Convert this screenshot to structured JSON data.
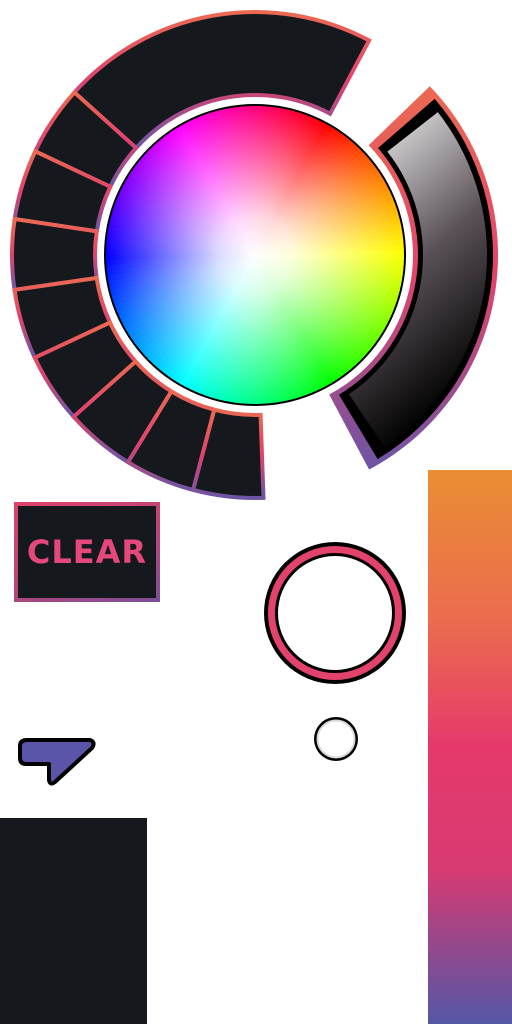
{
  "colors": {
    "dark": "#15181c",
    "accent_pink": "#e6396b",
    "accent_orange": "#ea8c36",
    "accent_purple": "#5a5aa8",
    "white": "#ffffff"
  },
  "controls": {
    "clear_label": "CLEAR",
    "palette_swatches": 8
  },
  "icons": {
    "color_wheel": "color-wheel-icon",
    "brightness": "brightness-slider-icon",
    "tool": "tool-arrow-icon",
    "brush_size": "brush-size-icon",
    "dot": "small-dot-icon"
  }
}
